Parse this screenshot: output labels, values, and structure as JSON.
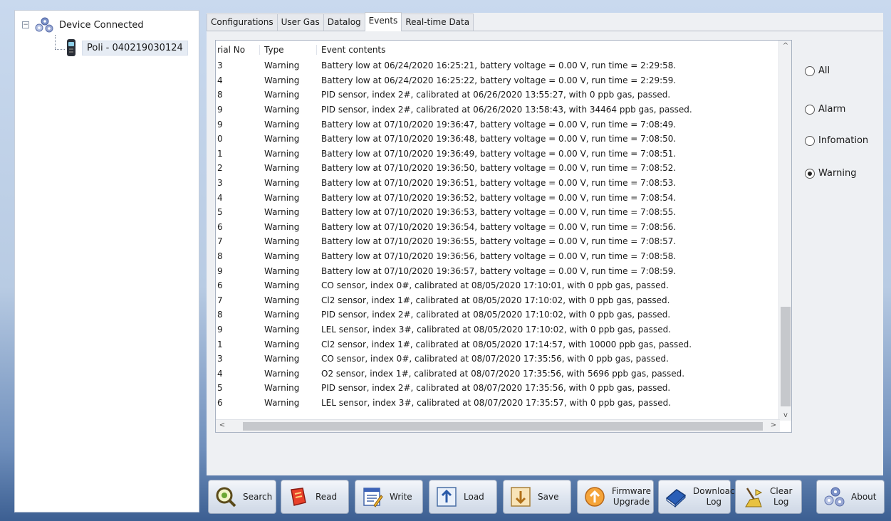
{
  "tree": {
    "root_label": "Device Connected",
    "expander": "−",
    "child_label": "Poli - 040219030124"
  },
  "tabs": [
    {
      "label": "Configurations"
    },
    {
      "label": "User Gas"
    },
    {
      "label": "Datalog"
    },
    {
      "label": "Events"
    },
    {
      "label": "Real-time Data"
    }
  ],
  "active_tab": "Events",
  "events": {
    "columns": {
      "serial": "rial No",
      "type": "Type",
      "contents": "Event contents"
    },
    "rows": [
      {
        "sn": "3",
        "type": "Warning",
        "content": "Battery low at 06/24/2020 16:25:21, battery voltage =  0.00 V, run time =  2:29:58."
      },
      {
        "sn": "4",
        "type": "Warning",
        "content": "Battery low at 06/24/2020 16:25:22, battery voltage =  0.00 V, run time =  2:29:59."
      },
      {
        "sn": "8",
        "type": "Warning",
        "content": "PID sensor, index 2#, calibrated at 06/26/2020 13:55:27, with 0 ppb gas, passed."
      },
      {
        "sn": "9",
        "type": "Warning",
        "content": "PID sensor, index 2#, calibrated at 06/26/2020 13:58:43, with 34464 ppb gas, passed."
      },
      {
        "sn": "9",
        "type": "Warning",
        "content": "Battery low at 07/10/2020 19:36:47, battery voltage =  0.00 V, run time =  7:08:49."
      },
      {
        "sn": "0",
        "type": "Warning",
        "content": "Battery low at 07/10/2020 19:36:48, battery voltage =  0.00 V, run time =  7:08:50."
      },
      {
        "sn": "1",
        "type": "Warning",
        "content": "Battery low at 07/10/2020 19:36:49, battery voltage =  0.00 V, run time =  7:08:51."
      },
      {
        "sn": "2",
        "type": "Warning",
        "content": "Battery low at 07/10/2020 19:36:50, battery voltage =  0.00 V, run time =  7:08:52."
      },
      {
        "sn": "3",
        "type": "Warning",
        "content": "Battery low at 07/10/2020 19:36:51, battery voltage =  0.00 V, run time =  7:08:53."
      },
      {
        "sn": "4",
        "type": "Warning",
        "content": "Battery low at 07/10/2020 19:36:52, battery voltage =  0.00 V, run time =  7:08:54."
      },
      {
        "sn": "5",
        "type": "Warning",
        "content": "Battery low at 07/10/2020 19:36:53, battery voltage =  0.00 V, run time =  7:08:55."
      },
      {
        "sn": "6",
        "type": "Warning",
        "content": "Battery low at 07/10/2020 19:36:54, battery voltage =  0.00 V, run time =  7:08:56."
      },
      {
        "sn": "7",
        "type": "Warning",
        "content": "Battery low at 07/10/2020 19:36:55, battery voltage =  0.00 V, run time =  7:08:57."
      },
      {
        "sn": "8",
        "type": "Warning",
        "content": "Battery low at 07/10/2020 19:36:56, battery voltage =  0.00 V, run time =  7:08:58."
      },
      {
        "sn": "9",
        "type": "Warning",
        "content": "Battery low at 07/10/2020 19:36:57, battery voltage =  0.00 V, run time =  7:08:59."
      },
      {
        "sn": "6",
        "type": "Warning",
        "content": "CO sensor, index 0#, calibrated at 08/05/2020 17:10:01, with 0 ppb gas, passed."
      },
      {
        "sn": "7",
        "type": "Warning",
        "content": "Cl2 sensor, index 1#, calibrated at 08/05/2020 17:10:02, with 0 ppb gas, passed."
      },
      {
        "sn": "8",
        "type": "Warning",
        "content": "PID sensor, index 2#, calibrated at 08/05/2020 17:10:02, with 0 ppb gas, passed."
      },
      {
        "sn": "9",
        "type": "Warning",
        "content": "LEL sensor, index 3#, calibrated at 08/05/2020 17:10:02, with 0 ppb gas, passed."
      },
      {
        "sn": "1",
        "type": "Warning",
        "content": "Cl2 sensor, index 1#, calibrated at 08/05/2020 17:14:57, with 10000 ppb gas, passed."
      },
      {
        "sn": "3",
        "type": "Warning",
        "content": "CO sensor, index 0#, calibrated at 08/07/2020 17:35:56, with 0 ppb gas, passed."
      },
      {
        "sn": "4",
        "type": "Warning",
        "content": "O2 sensor, index 1#, calibrated at 08/07/2020 17:35:56, with 5696 ppb gas, passed."
      },
      {
        "sn": "5",
        "type": "Warning",
        "content": "PID sensor, index 2#, calibrated at 08/07/2020 17:35:56, with 0 ppb gas, passed."
      },
      {
        "sn": "6",
        "type": "Warning",
        "content": "LEL sensor, index 3#, calibrated at 08/07/2020 17:35:57, with 0 ppb gas, passed."
      }
    ]
  },
  "scroll": {
    "up": "^",
    "down": "v",
    "left": "<",
    "right": ">"
  },
  "filters": [
    {
      "label": "All",
      "checked": false
    },
    {
      "label": "Alarm",
      "checked": false
    },
    {
      "label": "Infomation",
      "checked": false
    },
    {
      "label": "Warning",
      "checked": true
    }
  ],
  "toolbar": [
    {
      "name": "search",
      "label": "Search",
      "icon": "magnifier-icon"
    },
    {
      "name": "read",
      "label": "Read",
      "icon": "read-icon"
    },
    {
      "name": "write",
      "label": "Write",
      "icon": "write-icon"
    },
    {
      "name": "load",
      "label": "Load",
      "icon": "load-icon"
    },
    {
      "name": "save",
      "label": "Save",
      "icon": "save-icon"
    },
    {
      "name": "firmware-upgrade",
      "label": "Firmware\nUpgrade",
      "icon": "upgrade-icon"
    },
    {
      "name": "download-log",
      "label": "Downloac\nLog",
      "icon": "book-icon"
    },
    {
      "name": "clear-log",
      "label": "Clear\nLog",
      "icon": "broom-icon"
    },
    {
      "name": "about",
      "label": "About",
      "icon": "gears-icon"
    }
  ]
}
